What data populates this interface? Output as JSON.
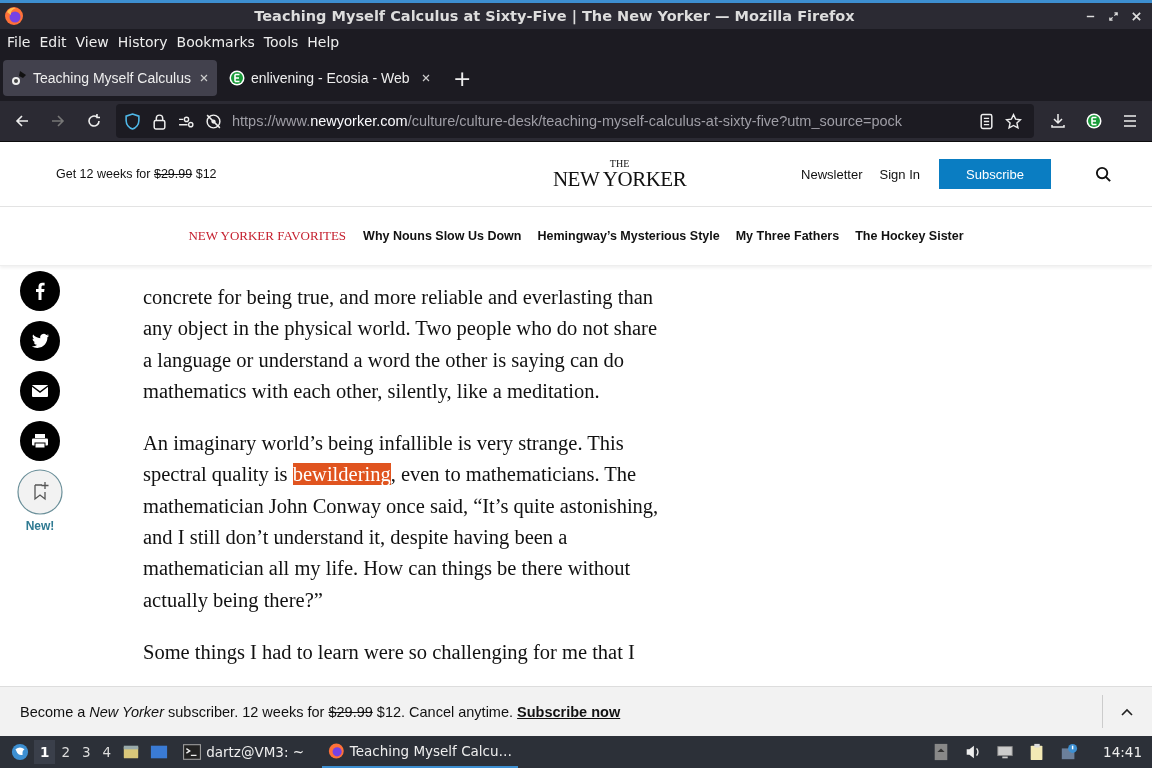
{
  "window": {
    "title": "Teaching Myself Calculus at Sixty-Five | The New Yorker — Mozilla Firefox"
  },
  "menu": [
    "File",
    "Edit",
    "View",
    "History",
    "Bookmarks",
    "Tools",
    "Help"
  ],
  "tabs": [
    {
      "label": "Teaching Myself Calculus",
      "selected": true,
      "kind": "page"
    },
    {
      "label": "enlivening - Ecosia - Web",
      "selected": false,
      "kind": "ecosia"
    }
  ],
  "new_tab": "+",
  "address": {
    "prefix": "https://www.",
    "host": "newyorker.com",
    "path": "/culture/culture-desk/teaching-myself-calculus-at-sixty-five?utm_source=pock"
  },
  "header": {
    "promo_before": "Get 12 weeks for",
    "promo_old_price": "$29.99",
    "promo_price": "$12",
    "logo_top": "THE",
    "logo": "NEW YORKER",
    "links": [
      "Newsletter",
      "Sign In"
    ],
    "subscribe": "Subscribe"
  },
  "nav": {
    "title": "NEW YORKER FAVORITES",
    "links": [
      "Why Nouns Slow Us Down",
      "Hemingway’s Mysterious Style",
      "My Three Fathers",
      "The Hockey Sister"
    ]
  },
  "share": {
    "new_label": "New!"
  },
  "article": [
    {
      "lines": [
        "concrete for being true, and more reliable and everlasting than",
        "any object in the physical world. Two people who do not share",
        "a language or understand a word the other is saying can do",
        "mathematics with each other, silently, like a meditation."
      ]
    },
    {
      "lines": [
        "An imaginary world’s being infallible is very strange. This",
        [
          {
            "text": "spectral quality is ",
            "selected": false
          },
          {
            "text": "bewildering",
            "selected": true
          },
          {
            "text": ", even to mathematicians. The",
            "selected": false
          }
        ],
        "mathematician John Conway once said, “It’s quite astonishing,",
        "and I still don’t understand it, despite having been a",
        "mathematician all my life. How can things be there without",
        "actually being there?”"
      ]
    },
    {
      "lines": [
        "Some things I had to learn were so challenging for me that I"
      ]
    }
  ],
  "banner": {
    "before": "Become a *New Yorker* subscriber. 12 weeks for",
    "old_price": "$29.99",
    "after": "$12. Cancel anytime.",
    "link": "Subscribe now"
  },
  "taskbar": {
    "workspaces": [
      {
        "label": "1",
        "selected": true
      },
      {
        "label": "2",
        "selected": false
      },
      {
        "label": "3",
        "selected": false
      },
      {
        "label": "4",
        "selected": false
      }
    ],
    "tasks": [
      {
        "label": "dartz@VM3: ~",
        "kind": "terminal",
        "selected": false
      },
      {
        "label": "Teaching Myself Calcu…",
        "kind": "firefox",
        "selected": true
      }
    ],
    "clock": "14:41"
  }
}
